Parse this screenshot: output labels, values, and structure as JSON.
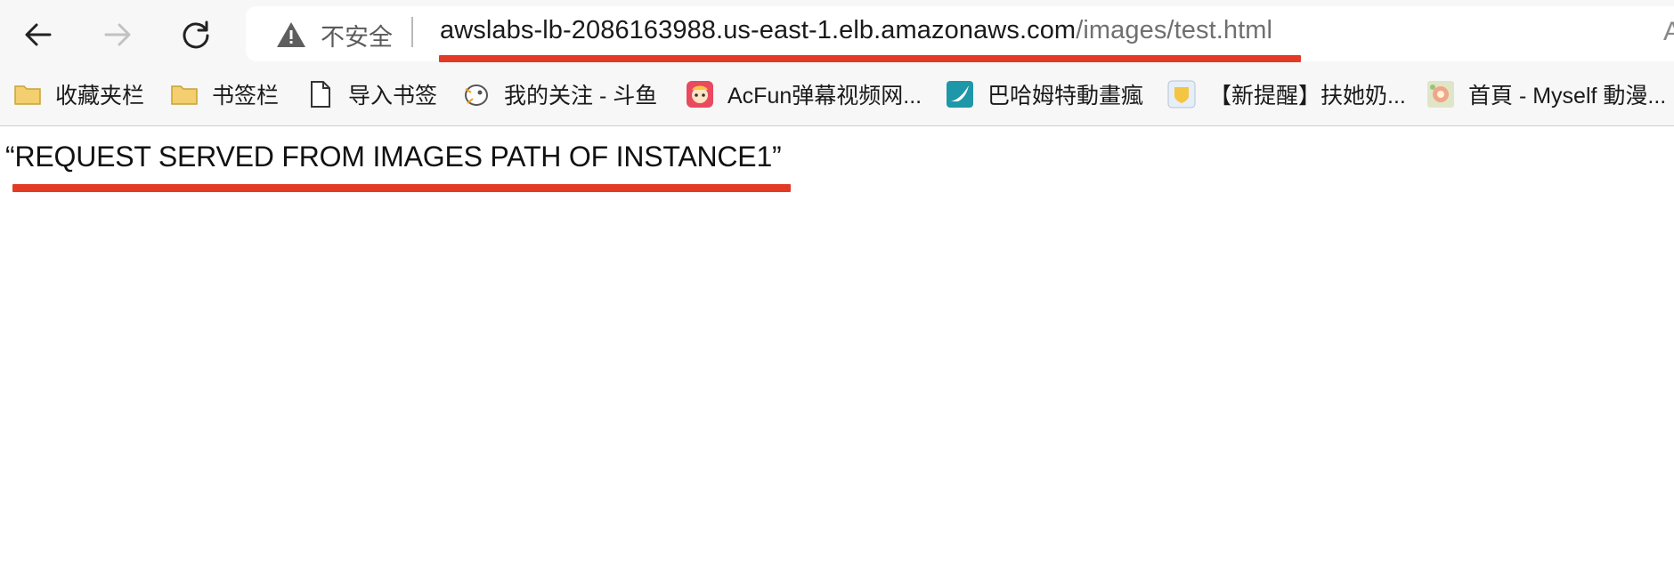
{
  "toolbar": {
    "back_icon": "arrow-left-icon",
    "forward_icon": "arrow-right-icon",
    "reload_icon": "reload-icon"
  },
  "address_bar": {
    "security_label": "不安全",
    "url_host": "awslabs-lb-2086163988.us-east-1.elb.amazonaws.com",
    "url_path": "/images/test.html",
    "read_aloud_glyph": "A"
  },
  "bookmarks": [
    {
      "label": "收藏夹栏",
      "icon": "folder-icon"
    },
    {
      "label": "书签栏",
      "icon": "folder-icon"
    },
    {
      "label": "导入书签",
      "icon": "page-icon"
    },
    {
      "label": "我的关注 - 斗鱼",
      "icon": "douyu-icon"
    },
    {
      "label": "AcFun弹幕视频网...",
      "icon": "acfun-icon"
    },
    {
      "label": "巴哈姆特動畫瘋",
      "icon": "bahamut-icon"
    },
    {
      "label": "【新提醒】扶她奶...",
      "icon": "site-icon"
    },
    {
      "label": "首頁 - Myself 動漫...",
      "icon": "myself-icon"
    }
  ],
  "page": {
    "message": "“REQUEST SERVED FROM IMAGES PATH OF INSTANCE1”"
  },
  "colors": {
    "highlight_underline": "#e23a25",
    "folder": "#f4cf6f"
  }
}
